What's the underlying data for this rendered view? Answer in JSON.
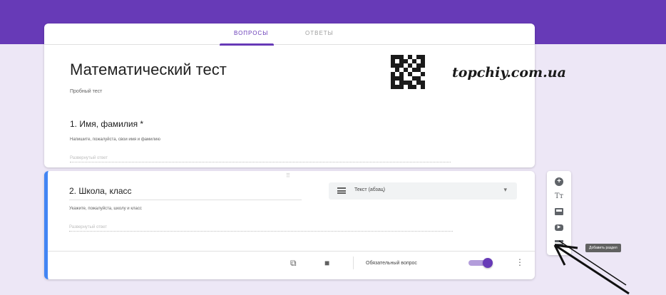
{
  "colors": {
    "header": "#673ab7",
    "background": "#ede7f6",
    "active_border": "#4285f4",
    "toggle_on": "#673ab7"
  },
  "tabs": [
    {
      "label": "вопросы",
      "active": true
    },
    {
      "label": "ответы",
      "active": false
    }
  ],
  "form": {
    "title": "Математический тест",
    "description": "Пробный тест"
  },
  "questions": [
    {
      "title": "1. Имя, фамилия *",
      "description": "Напишите, пожалуйста, свои имя и фамилию",
      "answer_placeholder": "Развернутый ответ"
    },
    {
      "title": "2. Школа, класс",
      "description": "Укажите, пожалуйста, школу и класс",
      "answer_placeholder": "Развернутый ответ",
      "type_label": "Текст (абзац)",
      "required_label": "Обязательный вопрос",
      "required": true
    }
  ],
  "watermark": "topchiy.com.ua",
  "side_toolbar": {
    "title_glyph": "Tт",
    "tooltip": "Добавить раздел"
  },
  "icons": [
    "qr-code-icon",
    "drag-handle-icon",
    "paragraph-icon",
    "chevron-down-icon",
    "copy-icon",
    "delete-icon",
    "more-vert-icon",
    "add-question-icon",
    "add-title-icon",
    "add-image-icon",
    "add-video-icon",
    "add-section-icon",
    "pointer-arrow-icon"
  ]
}
